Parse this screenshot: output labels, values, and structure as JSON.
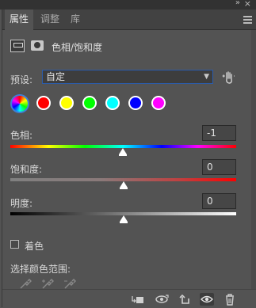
{
  "window": {
    "collapse_glyph": "»",
    "close_glyph": "×"
  },
  "tabs": [
    {
      "label": "属性",
      "active": true
    },
    {
      "label": "调整",
      "active": false
    },
    {
      "label": "库",
      "active": false
    }
  ],
  "panel": {
    "title": "色相/饱和度"
  },
  "preset": {
    "label": "预设:",
    "value": "自定"
  },
  "swatches": [
    {
      "name": "master",
      "color": "conic"
    },
    {
      "name": "reds",
      "color": "#ff0000"
    },
    {
      "name": "yellows",
      "color": "#ffff00"
    },
    {
      "name": "greens",
      "color": "#00ff00"
    },
    {
      "name": "cyans",
      "color": "#00ffff"
    },
    {
      "name": "blues",
      "color": "#0000ff"
    },
    {
      "name": "magentas",
      "color": "#ff00ff"
    }
  ],
  "sliders": {
    "hue": {
      "label": "色相:",
      "value": "-1",
      "position": 0.497
    },
    "saturation": {
      "label": "饱和度:",
      "value": "0",
      "position": 0.5
    },
    "lightness": {
      "label": "明度:",
      "value": "0",
      "position": 0.5
    }
  },
  "colorize": {
    "label": "着色",
    "checked": false
  },
  "range": {
    "label": "选择颜色范围:"
  },
  "colors": {
    "panel_bg": "#535353",
    "tab_bg": "#424242",
    "select_border": "#2b5cab",
    "master_ring": "#3f7fd8"
  },
  "footer": {
    "icons": [
      "clip-to-layer-icon",
      "view-previous-state-icon",
      "reset-icon",
      "visibility-eye-icon",
      "trash-icon"
    ]
  }
}
